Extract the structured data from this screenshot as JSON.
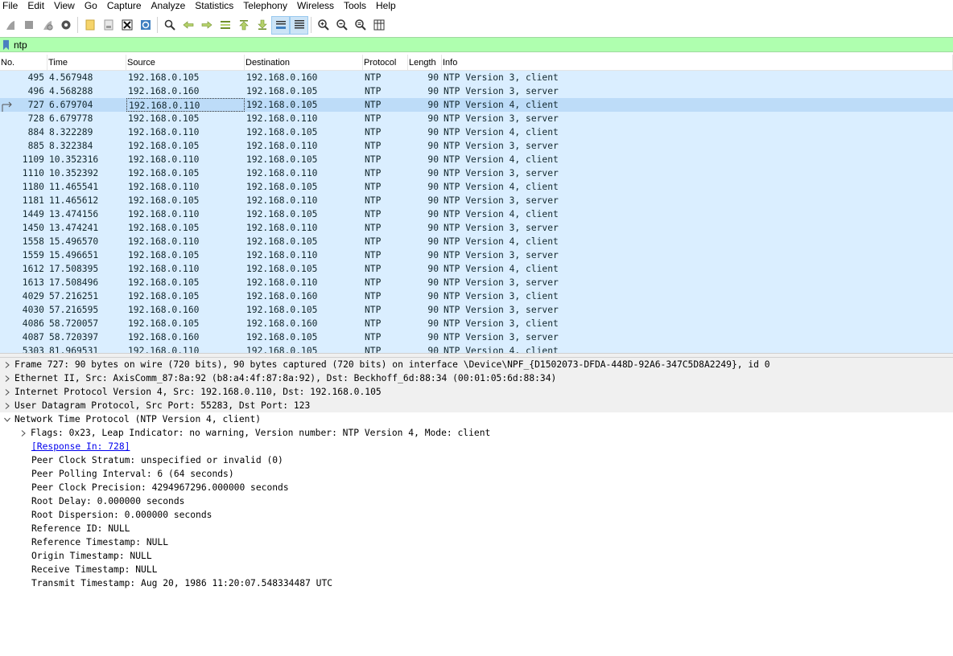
{
  "menu": [
    "File",
    "Edit",
    "View",
    "Go",
    "Capture",
    "Analyze",
    "Statistics",
    "Telephony",
    "Wireless",
    "Tools",
    "Help"
  ],
  "toolbar": {
    "icons": [
      "shark-fin-start-icon",
      "stop-square-icon",
      "restart-fin-icon",
      "gear-options-icon",
      "open-folder-icon",
      "save-file-icon",
      "close-file-icon",
      "reload-icon",
      "find-magnifier-icon",
      "go-back-arrow-icon",
      "go-forward-arrow-icon",
      "go-to-packet-icon",
      "go-first-icon",
      "go-last-icon",
      "autoscroll-icon",
      "colorize-icon",
      "zoom-in-icon",
      "zoom-out-icon",
      "zoom-normal-icon",
      "resize-columns-icon"
    ]
  },
  "filter": {
    "value": "ntp"
  },
  "columns": [
    "No.",
    "Time",
    "Source",
    "Destination",
    "Protocol",
    "Length",
    "Info"
  ],
  "packets": [
    {
      "no": "495",
      "time": "4.567948",
      "src": "192.168.0.105",
      "dst": "192.168.0.160",
      "proto": "NTP",
      "len": "90",
      "info": "NTP Version 3, client"
    },
    {
      "no": "496",
      "time": "4.568288",
      "src": "192.168.0.160",
      "dst": "192.168.0.105",
      "proto": "NTP",
      "len": "90",
      "info": "NTP Version 3, server"
    },
    {
      "no": "727",
      "time": "6.679704",
      "src": "192.168.0.110",
      "dst": "192.168.0.105",
      "proto": "NTP",
      "len": "90",
      "info": "NTP Version 4, client",
      "selected": true
    },
    {
      "no": "728",
      "time": "6.679778",
      "src": "192.168.0.105",
      "dst": "192.168.0.110",
      "proto": "NTP",
      "len": "90",
      "info": "NTP Version 3, server"
    },
    {
      "no": "884",
      "time": "8.322289",
      "src": "192.168.0.110",
      "dst": "192.168.0.105",
      "proto": "NTP",
      "len": "90",
      "info": "NTP Version 4, client"
    },
    {
      "no": "885",
      "time": "8.322384",
      "src": "192.168.0.105",
      "dst": "192.168.0.110",
      "proto": "NTP",
      "len": "90",
      "info": "NTP Version 3, server"
    },
    {
      "no": "1109",
      "time": "10.352316",
      "src": "192.168.0.110",
      "dst": "192.168.0.105",
      "proto": "NTP",
      "len": "90",
      "info": "NTP Version 4, client"
    },
    {
      "no": "1110",
      "time": "10.352392",
      "src": "192.168.0.105",
      "dst": "192.168.0.110",
      "proto": "NTP",
      "len": "90",
      "info": "NTP Version 3, server"
    },
    {
      "no": "1180",
      "time": "11.465541",
      "src": "192.168.0.110",
      "dst": "192.168.0.105",
      "proto": "NTP",
      "len": "90",
      "info": "NTP Version 4, client"
    },
    {
      "no": "1181",
      "time": "11.465612",
      "src": "192.168.0.105",
      "dst": "192.168.0.110",
      "proto": "NTP",
      "len": "90",
      "info": "NTP Version 3, server"
    },
    {
      "no": "1449",
      "time": "13.474156",
      "src": "192.168.0.110",
      "dst": "192.168.0.105",
      "proto": "NTP",
      "len": "90",
      "info": "NTP Version 4, client"
    },
    {
      "no": "1450",
      "time": "13.474241",
      "src": "192.168.0.105",
      "dst": "192.168.0.110",
      "proto": "NTP",
      "len": "90",
      "info": "NTP Version 3, server"
    },
    {
      "no": "1558",
      "time": "15.496570",
      "src": "192.168.0.110",
      "dst": "192.168.0.105",
      "proto": "NTP",
      "len": "90",
      "info": "NTP Version 4, client"
    },
    {
      "no": "1559",
      "time": "15.496651",
      "src": "192.168.0.105",
      "dst": "192.168.0.110",
      "proto": "NTP",
      "len": "90",
      "info": "NTP Version 3, server"
    },
    {
      "no": "1612",
      "time": "17.508395",
      "src": "192.168.0.110",
      "dst": "192.168.0.105",
      "proto": "NTP",
      "len": "90",
      "info": "NTP Version 4, client"
    },
    {
      "no": "1613",
      "time": "17.508496",
      "src": "192.168.0.105",
      "dst": "192.168.0.110",
      "proto": "NTP",
      "len": "90",
      "info": "NTP Version 3, server"
    },
    {
      "no": "4029",
      "time": "57.216251",
      "src": "192.168.0.105",
      "dst": "192.168.0.160",
      "proto": "NTP",
      "len": "90",
      "info": "NTP Version 3, client"
    },
    {
      "no": "4030",
      "time": "57.216595",
      "src": "192.168.0.160",
      "dst": "192.168.0.105",
      "proto": "NTP",
      "len": "90",
      "info": "NTP Version 3, server"
    },
    {
      "no": "4086",
      "time": "58.720057",
      "src": "192.168.0.105",
      "dst": "192.168.0.160",
      "proto": "NTP",
      "len": "90",
      "info": "NTP Version 3, client"
    },
    {
      "no": "4087",
      "time": "58.720397",
      "src": "192.168.0.160",
      "dst": "192.168.0.105",
      "proto": "NTP",
      "len": "90",
      "info": "NTP Version 3, server"
    },
    {
      "no": "5303",
      "time": "81.969531",
      "src": "192.168.0.110",
      "dst": "192.168.0.105",
      "proto": "NTP",
      "len": "90",
      "info": "NTP Version 4, client"
    }
  ],
  "details": {
    "top": [
      {
        "text": "Frame 727: 90 bytes on wire (720 bits), 90 bytes captured (720 bits) on interface \\Device\\NPF_{D1502073-DFDA-448D-92A6-347C5D8A2249}, id 0",
        "open": false
      },
      {
        "text": "Ethernet II, Src: AxisComm_87:8a:92 (b8:a4:4f:87:8a:92), Dst: Beckhoff_6d:88:34 (00:01:05:6d:88:34)",
        "open": false
      },
      {
        "text": "Internet Protocol Version 4, Src: 192.168.0.110, Dst: 192.168.0.105",
        "open": false
      },
      {
        "text": "User Datagram Protocol, Src Port: 55283, Dst Port: 123",
        "open": false
      },
      {
        "text": "Network Time Protocol (NTP Version 4, client)",
        "open": true
      }
    ],
    "flags": "Flags: 0x23, Leap Indicator: no warning, Version number: NTP Version 4, Mode: client",
    "response_link": "[Response In: 728]",
    "fields": [
      "Peer Clock Stratum: unspecified or invalid (0)",
      "Peer Polling Interval: 6 (64 seconds)",
      "Peer Clock Precision: 4294967296.000000 seconds",
      "Root Delay: 0.000000 seconds",
      "Root Dispersion: 0.000000 seconds",
      "Reference ID: NULL",
      "Reference Timestamp: NULL",
      "Origin Timestamp: NULL",
      "Receive Timestamp: NULL",
      "Transmit Timestamp: Aug 20, 1986 11:20:07.548334487 UTC"
    ]
  },
  "colors": {
    "row_bg": "#daeeff",
    "row_selected": "#bddcf8",
    "filter_ok": "#afffaf",
    "link": "#0000ee"
  }
}
